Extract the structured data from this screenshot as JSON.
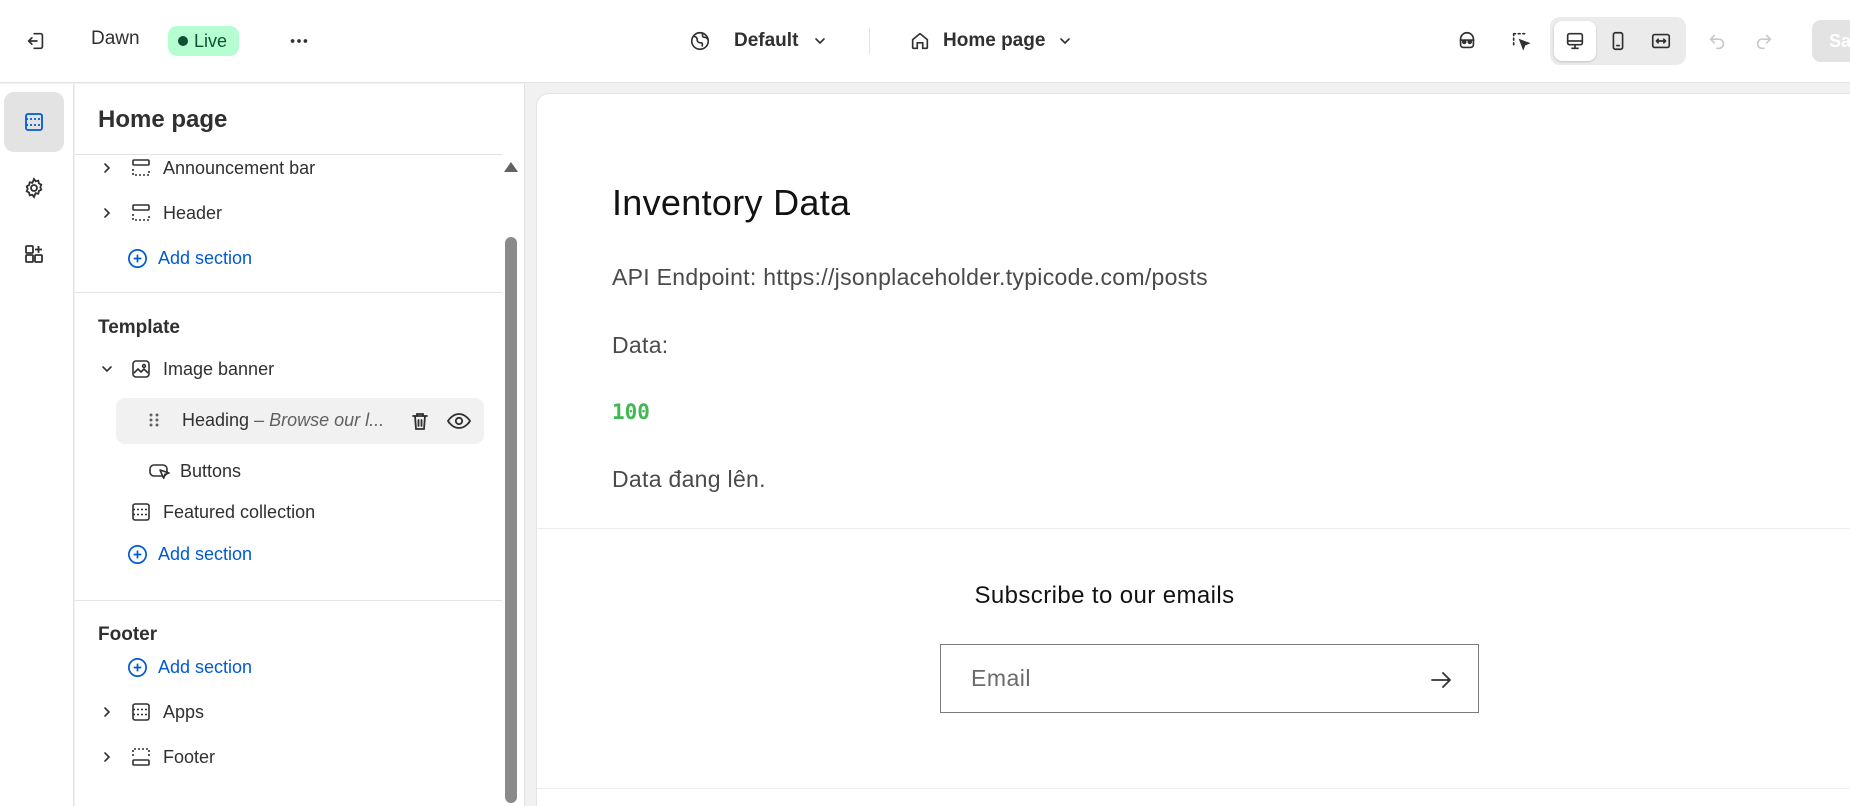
{
  "topbar": {
    "theme_name": "Dawn",
    "live_label": "Live",
    "language_label": "Default",
    "page_label": "Home page",
    "save_label": "Save"
  },
  "rail": {
    "items": [
      "sections-icon",
      "settings-icon",
      "apps-icon"
    ]
  },
  "sidebar": {
    "title": "Home page",
    "header_group": {
      "items": [
        {
          "label": "Announcement bar"
        },
        {
          "label": "Header"
        }
      ],
      "add_label": "Add section"
    },
    "template_group": {
      "title": "Template",
      "image_banner_label": "Image banner",
      "heading_block_label": "Heading",
      "heading_block_detail": "– Browse our l...",
      "buttons_label": "Buttons",
      "featured_collection_label": "Featured collection",
      "add_label": "Add section"
    },
    "footer_group": {
      "title": "Footer",
      "add_label": "Add section",
      "items": [
        {
          "label": "Apps"
        },
        {
          "label": "Footer"
        }
      ]
    }
  },
  "preview": {
    "title": "Inventory Data",
    "api_endpoint": "API Endpoint: https://jsonplaceholder.typicode.com/posts",
    "data_label": "Data:",
    "data_value": "100",
    "status_text": "Data đang lên.",
    "subscribe_title": "Subscribe to our emails",
    "email_placeholder": "Email"
  },
  "colors": {
    "accent_blue": "#005bd3",
    "live_green_bg": "#b4fed2",
    "data_green": "#3fb950"
  }
}
